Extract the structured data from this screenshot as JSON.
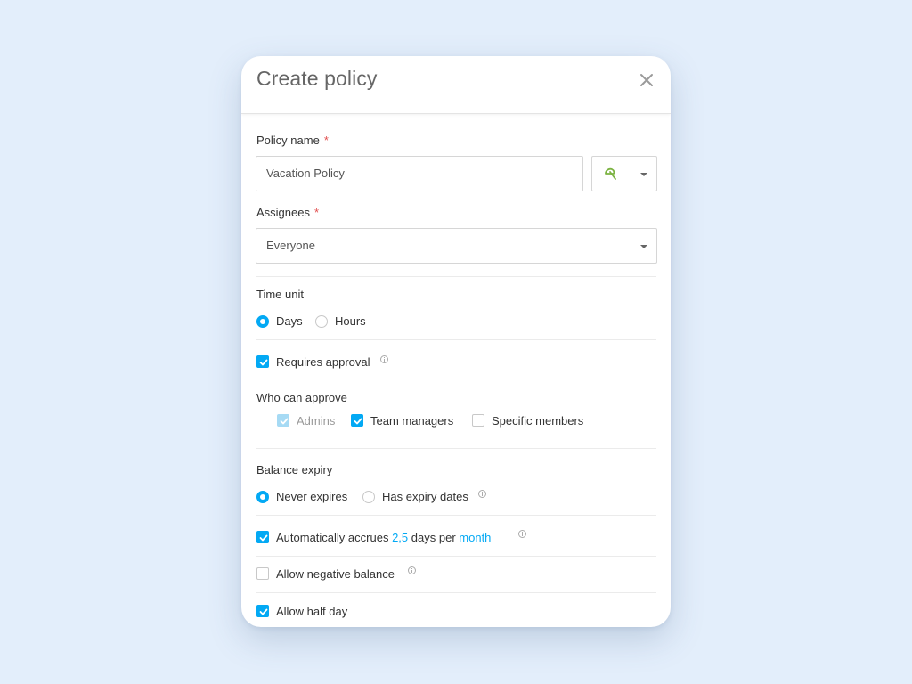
{
  "dialog": {
    "title": "Create policy"
  },
  "policy_name": {
    "label": "Policy name",
    "required_mark": "*",
    "value": "Vacation Policy",
    "icon": "umbrella-icon",
    "icon_color": "#7cb342"
  },
  "assignees": {
    "label": "Assignees",
    "required_mark": "*",
    "value": "Everyone"
  },
  "time_unit": {
    "label": "Time unit",
    "options": [
      "Days",
      "Hours"
    ],
    "selected": "Days"
  },
  "requires_approval": {
    "label": "Requires approval",
    "checked": true
  },
  "who_can_approve": {
    "label": "Who can approve",
    "options": [
      {
        "label": "Admins",
        "checked": true,
        "disabled": true
      },
      {
        "label": "Team managers",
        "checked": true,
        "disabled": false
      },
      {
        "label": "Specific members",
        "checked": false,
        "disabled": false
      }
    ]
  },
  "balance_expiry": {
    "label": "Balance expiry",
    "options": [
      "Never expires",
      "Has expiry dates"
    ],
    "selected": "Never expires"
  },
  "accrual": {
    "prefix": "Automatically accrues",
    "amount": "2,5",
    "middle": "days per",
    "period": "month",
    "checked": true
  },
  "negative_balance": {
    "label": "Allow negative balance",
    "checked": false
  },
  "half_day": {
    "label": "Allow half day",
    "checked": true
  },
  "colors": {
    "accent": "#03a9f4",
    "required": "#e25050",
    "background": "#e3eefb"
  }
}
